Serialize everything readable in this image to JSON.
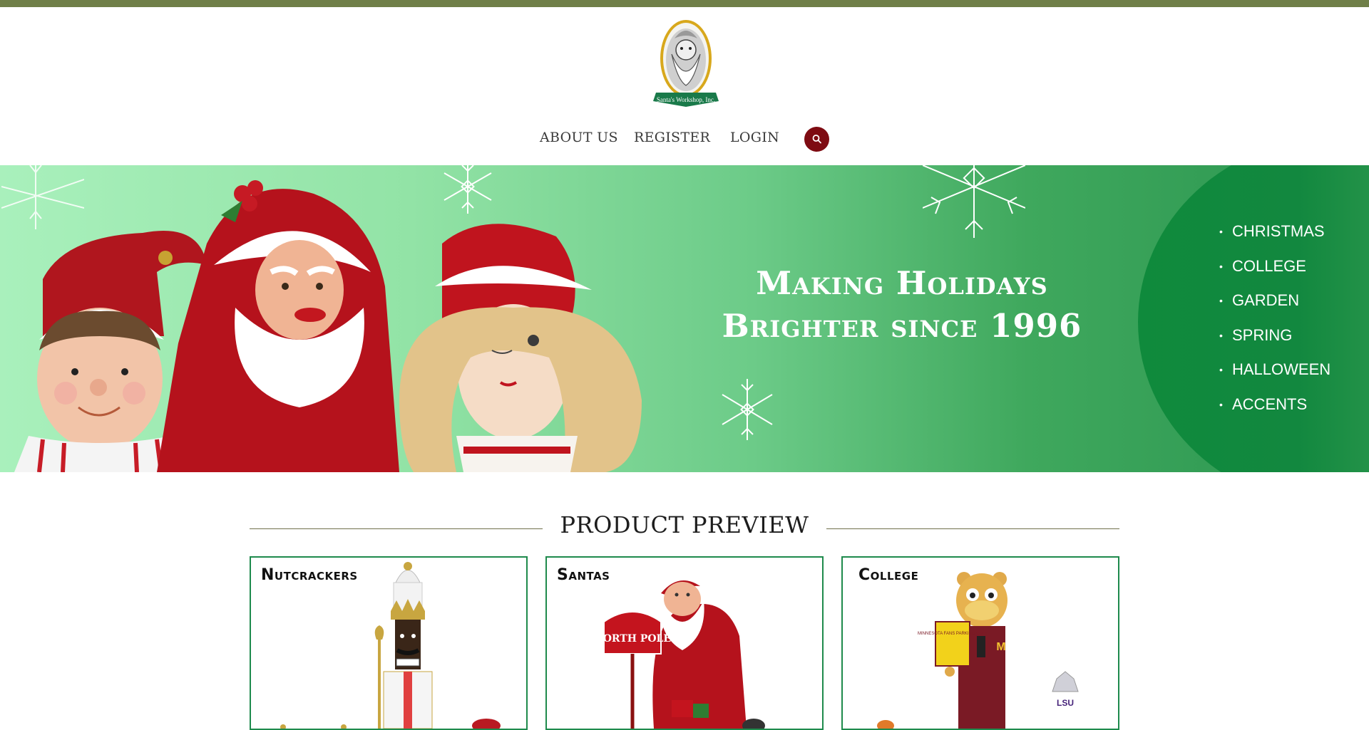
{
  "brand": {
    "logo_text": "Santa's Workshop, Inc."
  },
  "nav": {
    "items": [
      {
        "label": "ABOUT US"
      },
      {
        "label": "REGISTER"
      },
      {
        "label": "LOGIN"
      }
    ],
    "search_icon": "search-icon"
  },
  "hero": {
    "tagline_line1": "Making Holidays",
    "tagline_line2": "Brighter since 1996",
    "categories": [
      {
        "label": "CHRISTMAS"
      },
      {
        "label": "COLLEGE"
      },
      {
        "label": "GARDEN"
      },
      {
        "label": "SPRING"
      },
      {
        "label": "HALLOWEEN"
      },
      {
        "label": "ACCENTS"
      }
    ]
  },
  "product_preview": {
    "title": "PRODUCT PREVIEW",
    "cards": [
      {
        "title": "Nutcrackers"
      },
      {
        "title": "Santas"
      },
      {
        "title": "College",
        "sign_text": "MINNESOTA FANS PARKING ONLY",
        "badge_text": "LSU"
      }
    ],
    "santas_sign_text": "NORTH POLE"
  },
  "colors": {
    "top_bar": "#6f7f48",
    "search_button": "#7e0b12",
    "hero_green": "#12883f",
    "card_border": "#1e8a4c"
  }
}
